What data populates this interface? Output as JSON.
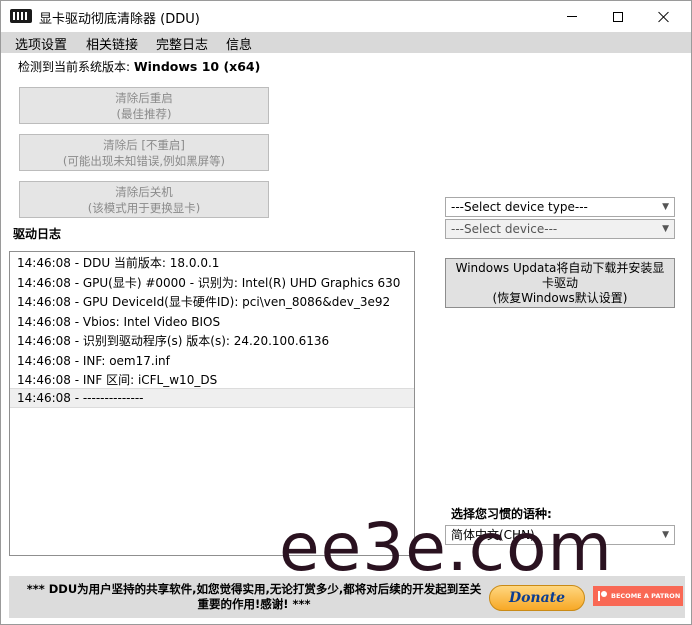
{
  "window": {
    "title": "显卡驱动彻底清除器 (DDU)"
  },
  "menu": {
    "items": [
      "选项设置",
      "相关链接",
      "完整日志",
      "信息"
    ]
  },
  "detect": {
    "label": "检测到当前系统版本: ",
    "value": "Windows 10 (x64)"
  },
  "actions": [
    {
      "line1": "清除后重启",
      "line2": "(最佳推荐)"
    },
    {
      "line1": "清除后 [不重启]",
      "line2": "(可能出现未知错误,例如黑屏等)"
    },
    {
      "line1": "清除后关机",
      "line2": "(该模式用于更换显卡)"
    }
  ],
  "log": {
    "label": "驱动日志",
    "entries": [
      "14:46:08 - DDU 当前版本: 18.0.0.1",
      "14:46:08 - GPU(显卡) #0000 - 识别为: Intel(R) UHD Graphics 630",
      "14:46:08 - GPU DeviceId(显卡硬件ID): pci\\ven_8086&dev_3e92",
      "14:46:08 - Vbios: Intel Video BIOS",
      "14:46:08 - 识别到驱动程序(s) 版本(s): 24.20.100.6136",
      "14:46:08 - INF: oem17.inf",
      "14:46:08 - INF 区间: iCFL_w10_DS",
      "14:46:08 - --------------"
    ]
  },
  "device": {
    "type_value": "---Select device type---",
    "device_value": "---Select device---"
  },
  "windows_update": {
    "line1": "Windows Updata将自动下载并安装显",
    "line2": "卡驱动",
    "line3": "(恢复Windows默认设置)"
  },
  "language": {
    "label": "选择您习惯的语种:",
    "value": "简体中文(CHN)"
  },
  "footer": {
    "line1": "*** DDU为用户坚持的共享软件,如您觉得实用,无论打赏多少,都将对后续的开发起到至关",
    "line2": "重要的作用!感谢! ***",
    "donate_label": "Donate",
    "patron_label": "BECOME A PATRON"
  },
  "watermark": {
    "text": "ee3e.com"
  },
  "colors": {
    "menubar": "#d9d9d9",
    "footer": "#dcdcdc",
    "patron": "#f96854",
    "donate": "#f7a826"
  }
}
